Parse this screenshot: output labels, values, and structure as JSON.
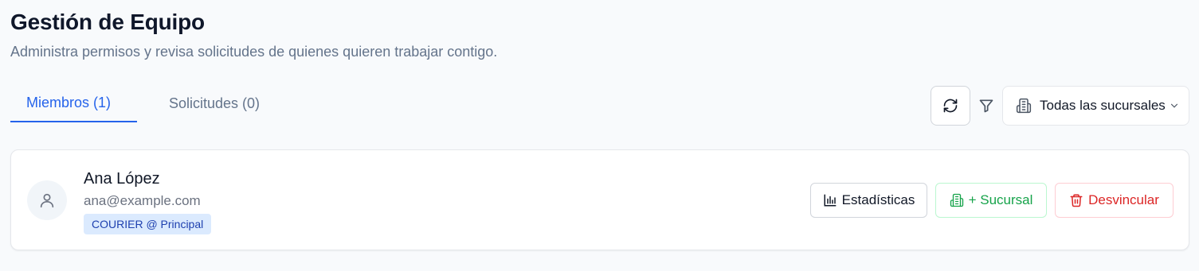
{
  "header": {
    "title": "Gestión de Equipo",
    "subtitle": "Administra permisos y revisa solicitudes de quienes quieren trabajar contigo."
  },
  "tabs": [
    {
      "label": "Miembros (1)",
      "active": true
    },
    {
      "label": "Solicitudes (0)",
      "active": false
    }
  ],
  "toolbar": {
    "refresh_icon": "refresh-icon",
    "filter_icon": "filter-icon",
    "branch_filter": {
      "selected": "Todas las sucursales",
      "icon": "building-icon"
    }
  },
  "members": [
    {
      "name": "Ana López",
      "email": "ana@example.com",
      "role_badge": "COURIER @ Principal",
      "actions": {
        "stats_label": "Estadísticas",
        "branch_label": "+ Sucursal",
        "unlink_label": "Desvincular"
      }
    }
  ],
  "colors": {
    "accent": "#2563eb",
    "success": "#16a34a",
    "danger": "#dc2626",
    "badge_bg": "#dbeafe",
    "badge_text": "#1e40af"
  }
}
